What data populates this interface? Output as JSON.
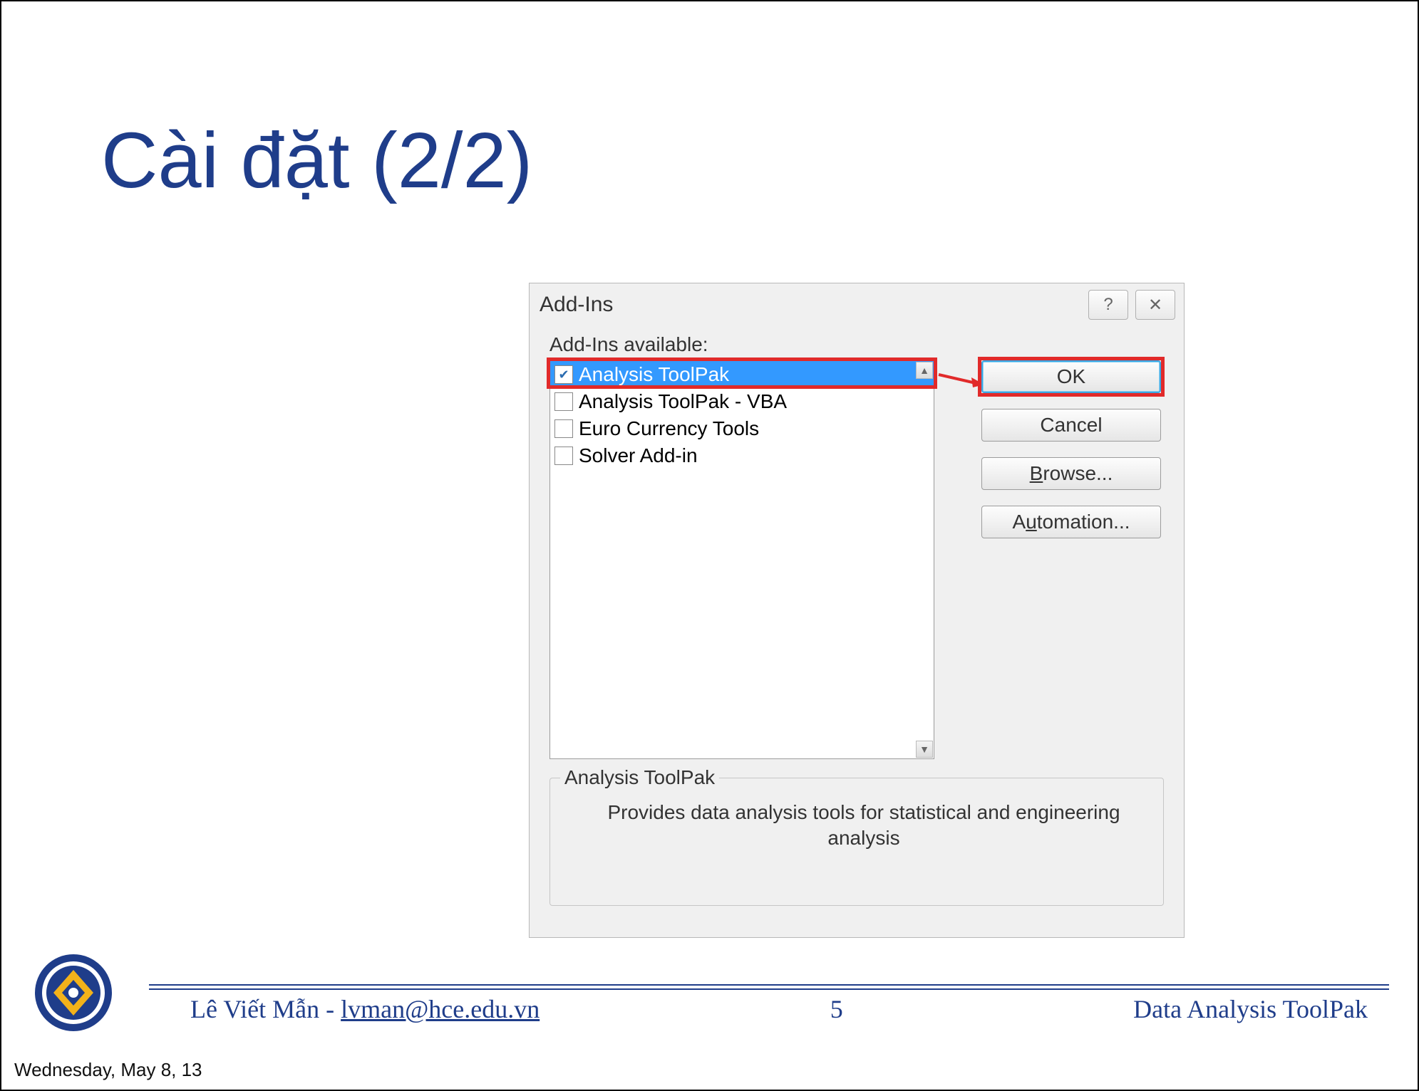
{
  "slide": {
    "title": "Cài đặt (2/2)",
    "page_number": "5",
    "topic": "Data Analysis ToolPak",
    "author": "Lê Viết Mẫn",
    "email": "lvman@hce.edu.vn"
  },
  "presenter_date": "Wednesday, May 8, 13",
  "dialog": {
    "title": "Add-Ins",
    "label_available": "Add-Ins available:",
    "help_glyph": "?",
    "close_glyph": "✕",
    "addins": [
      {
        "label": "Analysis ToolPak",
        "checked": true,
        "selected": true
      },
      {
        "label": "Analysis ToolPak - VBA",
        "checked": false,
        "selected": false
      },
      {
        "label": "Euro Currency Tools",
        "checked": false,
        "selected": false
      },
      {
        "label": "Solver Add-in",
        "checked": false,
        "selected": false
      }
    ],
    "buttons": {
      "ok": "OK",
      "cancel": "Cancel",
      "browse_pre": "B",
      "browse_rest": "rowse...",
      "automation_pre": "A",
      "automation_rest": "utomation..."
    },
    "description": {
      "legend": "Analysis ToolPak",
      "text": "Provides data analysis tools for statistical and engineering analysis"
    }
  }
}
